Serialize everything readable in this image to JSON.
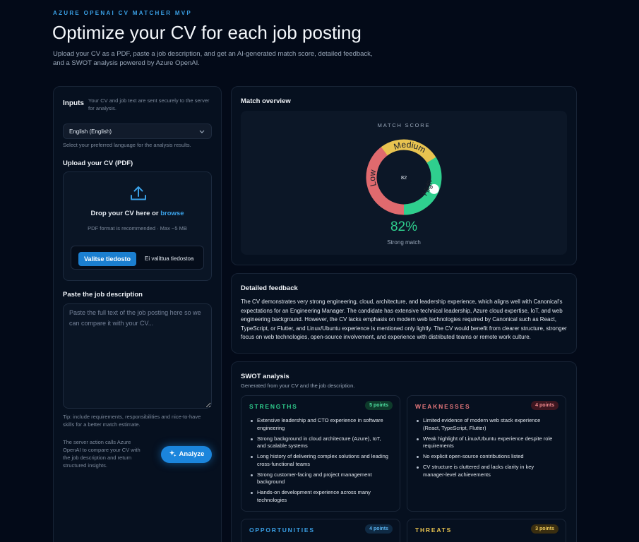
{
  "header": {
    "eyebrow": "AZURE OPENAI CV MATCHER MVP",
    "title": "Optimize your CV for each job posting",
    "subtitle": "Upload your CV as a PDF, paste a job description, and get an AI-generated match score, detailed feedback, and a SWOT analysis powered by Azure OpenAI."
  },
  "inputs": {
    "title": "Inputs",
    "note": "Your CV and job text are sent securely to the server for analysis.",
    "language": {
      "selected": "English (English)",
      "help": "Select your preferred language for the analysis results."
    },
    "upload": {
      "label": "Upload your CV (PDF)",
      "drop_text": "Drop your CV here or ",
      "browse": "browse",
      "hint": "PDF format is recommended · Max ~5 MB",
      "file_button": "Valitse tiedosto",
      "file_status": "Ei valittua tiedostoa"
    },
    "job": {
      "label": "Paste the job description",
      "placeholder": "Paste the full text of the job posting here so we can compare it with your CV...",
      "tip": "Tip: include requirements, responsibilities and nice-to-have skills for a better match estimate."
    },
    "action_note": "The server action calls Azure OpenAI to compare your CV with the job description and return structured insights.",
    "analyze_label": "Analyze"
  },
  "overview": {
    "title": "Match overview",
    "score_label": "MATCH SCORE",
    "score": 82,
    "score_text": "82",
    "percent_text": "82%",
    "verdict": "Strong match",
    "gauge": {
      "low": "Low",
      "medium": "Medium",
      "high": "High",
      "colors": {
        "low": "#e06a6e",
        "medium": "#e8c350",
        "high": "#2fcf8e"
      }
    }
  },
  "feedback": {
    "title": "Detailed feedback",
    "text": "The CV demonstrates very strong engineering, cloud, architecture, and leadership experience, which aligns well with Canonical's expectations for an Engineering Manager. The candidate has extensive technical leadership, Azure cloud expertise, IoT, and web engineering background. However, the CV lacks emphasis on modern web technologies required by Canonical such as React, TypeScript, or Flutter, and Linux/Ubuntu experience is mentioned only lightly. The CV would benefit from clearer structure, stronger focus on web technologies, open-source involvement, and experience with distributed teams or remote work culture."
  },
  "swot": {
    "title": "SWOT analysis",
    "subtitle": "Generated from your CV and the job description.",
    "strengths": {
      "title": "STRENGTHS",
      "badge": "5 points",
      "color": "#2fcf8e",
      "items": [
        "Extensive leadership and CTO experience in software engineering",
        "Strong background in cloud architecture (Azure), IoT, and scalable systems",
        "Long history of delivering complex solutions and leading cross-functional teams",
        "Strong customer-facing and project management background",
        "Hands-on development experience across many technologies"
      ]
    },
    "weaknesses": {
      "title": "WEAKNESSES",
      "badge": "4 points",
      "color": "#e06a6e",
      "items": [
        "Limited evidence of modern web stack experience (React, TypeScript, Flutter)",
        "Weak highlight of Linux/Ubuntu experience despite role requirements",
        "No explicit open-source contributions listed",
        "CV structure is cluttered and lacks clarity in key manager-level achievements"
      ]
    },
    "opportunities": {
      "title": "OPPORTUNITIES",
      "badge": "4 points",
      "color": "#3aa0e6"
    },
    "threats": {
      "title": "THREATS",
      "badge": "3 points",
      "color": "#e8c350"
    }
  }
}
